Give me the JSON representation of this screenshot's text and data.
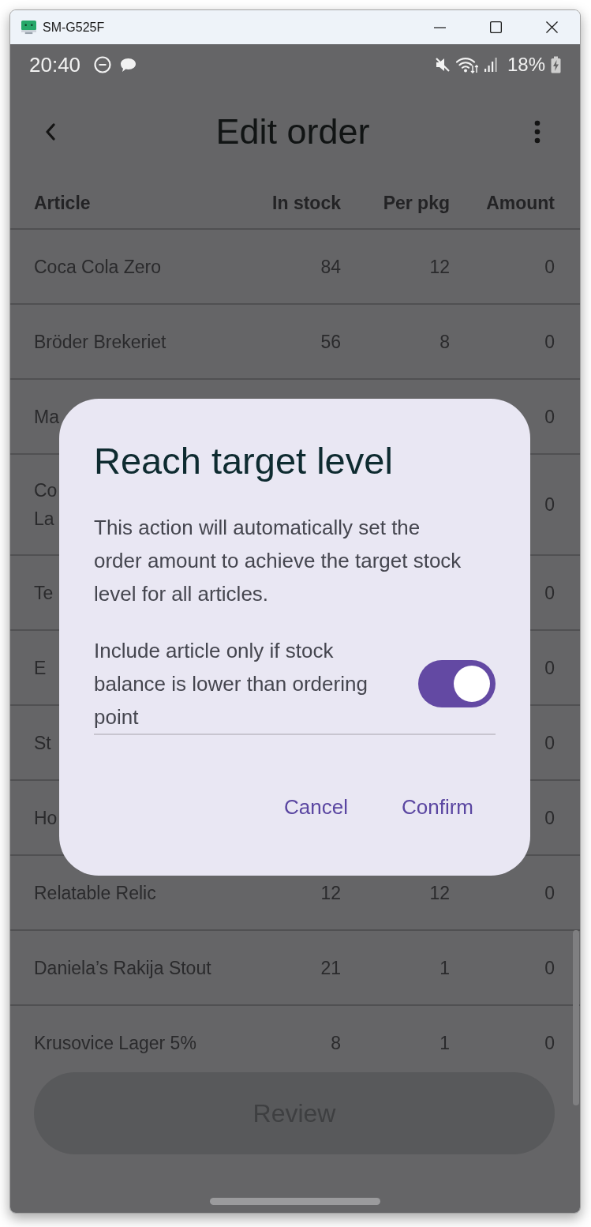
{
  "window": {
    "title": "SM-G525F"
  },
  "status_bar": {
    "time": "20:40",
    "battery": "18%"
  },
  "app_bar": {
    "title": "Edit order"
  },
  "table": {
    "columns": [
      "Article",
      "In stock",
      "Per pkg",
      "Amount"
    ],
    "rows": [
      {
        "article": "Coca Cola Zero",
        "in_stock": "84",
        "per_pkg": "12",
        "amount": "0"
      },
      {
        "article": "Bröder Brekeriet",
        "in_stock": "56",
        "per_pkg": "8",
        "amount": "0"
      },
      {
        "article": "Ma",
        "amount": "0"
      },
      {
        "article": "Co\nLa",
        "amount": "0"
      },
      {
        "article": "Te",
        "amount": "0"
      },
      {
        "article": "E",
        "amount": "0"
      },
      {
        "article": "St",
        "amount": "0"
      },
      {
        "article": "Ho",
        "amount": "0"
      },
      {
        "article": "Relatable Relic",
        "in_stock": "12",
        "per_pkg": "12",
        "amount": "0"
      },
      {
        "article": "Daniela’s Rakija Stout",
        "in_stock": "21",
        "per_pkg": "1",
        "amount": "0"
      },
      {
        "article": "Krusovice Lager 5%",
        "in_stock": "8",
        "per_pkg": "1",
        "amount": "0"
      }
    ]
  },
  "review_button": {
    "label": "Review"
  },
  "dialog": {
    "title": "Reach target level",
    "message": "This action will automatically set the order amount to achieve the target stock level for all articles.",
    "toggle": {
      "label": "Include article only if stock balance is lower than ordering point",
      "on": true
    },
    "buttons": [
      "Cancel",
      "Confirm"
    ]
  }
}
